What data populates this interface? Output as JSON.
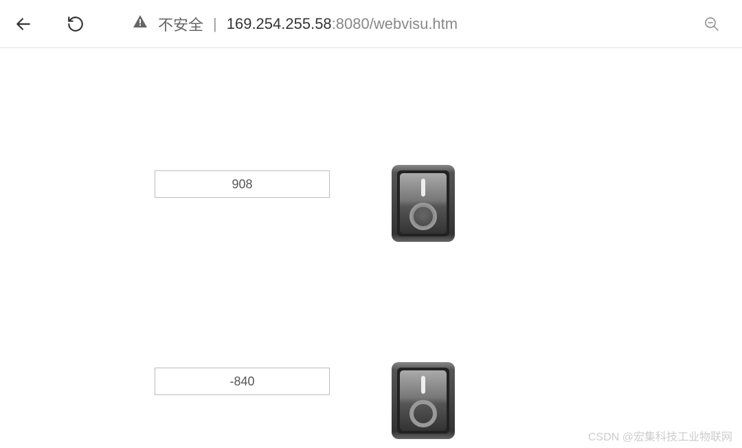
{
  "browser": {
    "securityLabel": "不安全",
    "separator": "|",
    "urlHost": "169.254.255.58",
    "urlPortPath": ":8080/webvisu.htm"
  },
  "content": {
    "rows": [
      {
        "value": "908",
        "switch": "on"
      },
      {
        "value": "-840",
        "switch": "on"
      }
    ]
  },
  "watermark": "CSDN @宏集科技工业物联网"
}
